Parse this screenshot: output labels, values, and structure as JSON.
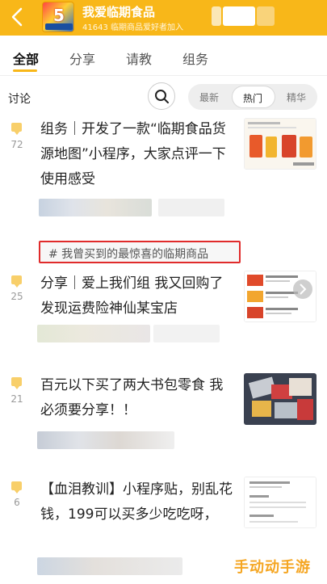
{
  "header": {
    "title": "我爱临期食品",
    "subtitle": "41643 临期商品爱好者加入",
    "logo_text": "5",
    "accent_color": "#f8b719"
  },
  "tabs": [
    {
      "label": "全部",
      "active": true
    },
    {
      "label": "分享",
      "active": false
    },
    {
      "label": "请教",
      "active": false
    },
    {
      "label": "组务",
      "active": false
    }
  ],
  "filter": {
    "section_label": "讨论",
    "segments": [
      "最新",
      "热门",
      "精华"
    ],
    "active_segment": "热门"
  },
  "topic_tag": "# 我曾买到的最惊喜的临期商品",
  "posts": [
    {
      "count": "72",
      "text": "组务｜开发了一款“临期食品货源地图”小程序，大家点评一下使用感受",
      "thumb": "app-screenshot"
    },
    {
      "count": "25",
      "text": "分享｜爱上我们组 我又回购了 发现运费险神仙某宝店",
      "thumb": "product-list"
    },
    {
      "count": "21",
      "text": "百元以下买了两大书包零食 我必须要分享！！",
      "thumb": "snacks-photo"
    },
    {
      "count": "6",
      "text": "【血泪教训】小程序贴，别乱花钱，199可以买多少吃吃呀，",
      "thumb": "document-screenshot"
    }
  ],
  "watermark": "手动动手游"
}
